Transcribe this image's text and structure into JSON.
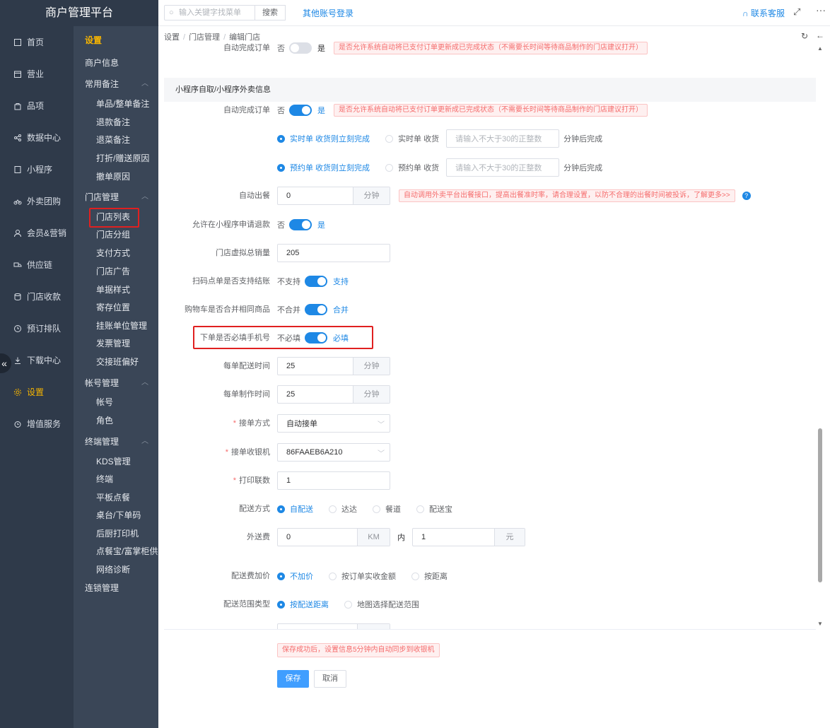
{
  "brand": "商户管理平台",
  "topbar": {
    "search_placeholder": "输入关键字找菜单",
    "search_button": "搜索",
    "other_login": "其他账号登录",
    "contact": "联系客服"
  },
  "nav1": [
    {
      "label": "首页",
      "icon": "home-icon"
    },
    {
      "label": "营业",
      "icon": "calendar-icon"
    },
    {
      "label": "品项",
      "icon": "bag-icon"
    },
    {
      "label": "数据中心",
      "icon": "share-icon"
    },
    {
      "label": "小程序",
      "icon": "device-icon"
    },
    {
      "label": "外卖团购",
      "icon": "bike-icon"
    },
    {
      "label": "会员&营销",
      "icon": "user-icon"
    },
    {
      "label": "供应链",
      "icon": "truck-icon"
    },
    {
      "label": "门店收款",
      "icon": "database-icon"
    },
    {
      "label": "预订排队",
      "icon": "clock-icon"
    },
    {
      "label": "下载中心",
      "icon": "download-icon"
    },
    {
      "label": "设置",
      "icon": "gear-icon"
    },
    {
      "label": "增值服务",
      "icon": "alarm-icon"
    }
  ],
  "nav2": {
    "title": "设置",
    "items": [
      {
        "label": "商户信息",
        "kind": "group"
      },
      {
        "label": "常用备注",
        "kind": "group",
        "caret": true
      },
      {
        "label": "单品/整单备注",
        "kind": "sub"
      },
      {
        "label": "退款备注",
        "kind": "sub"
      },
      {
        "label": "退菜备注",
        "kind": "sub"
      },
      {
        "label": "打折/赠送原因",
        "kind": "sub"
      },
      {
        "label": "撤单原因",
        "kind": "sub"
      },
      {
        "label": "门店管理",
        "kind": "group",
        "caret": true
      },
      {
        "label": "门店列表",
        "kind": "sub"
      },
      {
        "label": "门店分组",
        "kind": "sub"
      },
      {
        "label": "支付方式",
        "kind": "sub"
      },
      {
        "label": "门店广告",
        "kind": "sub"
      },
      {
        "label": "单据样式",
        "kind": "sub"
      },
      {
        "label": "寄存位置",
        "kind": "sub"
      },
      {
        "label": "挂账单位管理",
        "kind": "sub"
      },
      {
        "label": "发票管理",
        "kind": "sub"
      },
      {
        "label": "交接班偏好",
        "kind": "sub"
      },
      {
        "label": "帐号管理",
        "kind": "group",
        "caret": true
      },
      {
        "label": "帐号",
        "kind": "sub"
      },
      {
        "label": "角色",
        "kind": "sub"
      },
      {
        "label": "终端管理",
        "kind": "group",
        "caret": true
      },
      {
        "label": "KDS管理",
        "kind": "sub"
      },
      {
        "label": "终端",
        "kind": "sub"
      },
      {
        "label": "平板点餐",
        "kind": "sub"
      },
      {
        "label": "桌台/下单码",
        "kind": "sub"
      },
      {
        "label": "后厨打印机",
        "kind": "sub"
      },
      {
        "label": "点餐宝/富掌柜供应",
        "kind": "sub"
      },
      {
        "label": "网络诊断",
        "kind": "sub"
      },
      {
        "label": "连锁管理",
        "kind": "group"
      }
    ]
  },
  "breadcrumb": [
    "设置",
    "门店管理",
    "编辑门店"
  ],
  "form": {
    "top_cut": {
      "label": "自动完成订单",
      "off": "否",
      "on": "是",
      "tip": "是否允许系统自动将已支付订单更新成已完成状态（不需要长时间等待商品制作的门店建议打开）"
    },
    "section_title": "小程序自取/小程序外卖信息",
    "auto_complete": {
      "label": "自动完成订单",
      "off": "否",
      "on": "是",
      "tip": "是否允许系统自动将已支付订单更新成已完成状态（不需要长时间等待商品制作的门店建议打开）"
    },
    "realtime": {
      "opt1": "实时单 收货则立刻完成",
      "opt2": "实时单 收货",
      "placeholder": "请输入不大于30的正整数",
      "suffix": "分钟后完成"
    },
    "preorder": {
      "opt1": "预约单 收货则立刻完成",
      "opt2": "预约单 收货",
      "placeholder": "请输入不大于30的正整数",
      "suffix": "分钟后完成"
    },
    "auto_meal": {
      "label": "自动出餐",
      "value": "0",
      "unit": "分钟",
      "tip": "自动调用外卖平台出餐接口，提高出餐准时率，请合理设置，以防不合理的出餐时间被投诉，了解更多>>"
    },
    "allow_refund": {
      "label": "允许在小程序申请退款",
      "off": "否",
      "on": "是"
    },
    "virtual_sales": {
      "label": "门店虚拟总销量",
      "value": "205"
    },
    "scan_checkout": {
      "label": "扫码点单是否支持结账",
      "off": "不支持",
      "on": "支持"
    },
    "merge_cart": {
      "label": "购物车是否合并相同商品",
      "off": "不合并",
      "on": "合并"
    },
    "require_phone": {
      "label": "下单是否必填手机号",
      "off": "不必填",
      "on": "必填"
    },
    "delivery_time": {
      "label": "每单配送时间",
      "value": "25",
      "unit": "分钟"
    },
    "make_time": {
      "label": "每单制作时间",
      "value": "25",
      "unit": "分钟"
    },
    "accept_mode": {
      "label": "接单方式",
      "value": "自动接单"
    },
    "accept_cashier": {
      "label": "接单收银机",
      "value": "86FAAEB6A210"
    },
    "print_copies": {
      "label": "打印联数",
      "value": "1"
    },
    "delivery_mode": {
      "label": "配送方式",
      "options": [
        "自配送",
        "达达",
        "餐道",
        "配送宝"
      ]
    },
    "delivery_fee": {
      "label": "外送费",
      "value1": "0",
      "unit1": "KM",
      "mid": "内",
      "value2": "1",
      "unit2": "元"
    },
    "fee_markup": {
      "label": "配送费加价",
      "options": [
        "不加价",
        "按订单实收金额",
        "按距离"
      ]
    },
    "range_type": {
      "label": "配送范围类型",
      "options": [
        "按配送距离",
        "地图选择配送范围"
      ]
    }
  },
  "footer": {
    "tip": "保存成功后，设置信息5分钟内自动同步到收银机",
    "save": "保存",
    "cancel": "取消"
  }
}
